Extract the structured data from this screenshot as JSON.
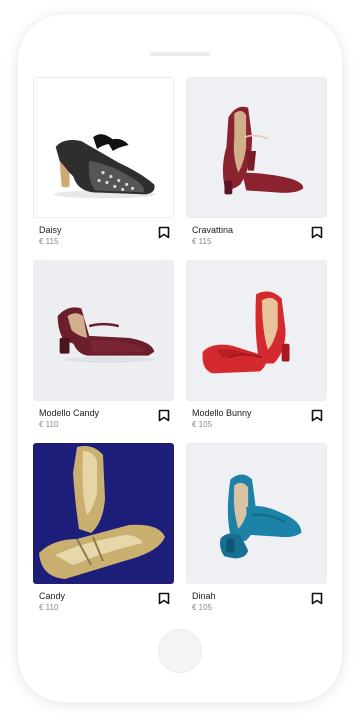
{
  "products": [
    {
      "name": "Daisy",
      "price": "€ 115"
    },
    {
      "name": "Cravattina",
      "price": "€ 115"
    },
    {
      "name": "Modello Candy",
      "price": "€ 110"
    },
    {
      "name": "Modello Bunny",
      "price": "€ 105"
    },
    {
      "name": "Candy",
      "price": "€ 110"
    },
    {
      "name": "Dinah",
      "price": "€ 105"
    }
  ],
  "icons": {
    "bookmark": "bookmark-icon"
  },
  "colors": {
    "background": "#ffffff",
    "text": "#202020",
    "price": "#8a8a8a",
    "shoe_daisy": "#2b2b2b",
    "shoe_cravattina": "#8b2230",
    "shoe_modello_candy": "#6a1f2a",
    "shoe_bunny": "#d42a2f",
    "shoe_candy_gold": "#c9b071",
    "shoe_candy_bg": "#1d1d7a",
    "shoe_dinah": "#1c82a8"
  }
}
